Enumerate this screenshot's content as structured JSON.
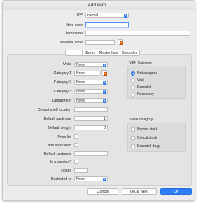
{
  "window": {
    "title": "Add item..."
  },
  "top": {
    "type_label": "Type",
    "type_value": "normal",
    "item_code_label": "Item code",
    "item_code_value": "",
    "item_name_label": "Item name",
    "item_name_value": "",
    "universal_code_label": "Universal code",
    "universal_code_value": ""
  },
  "tabs": [
    {
      "label": ""
    },
    {
      "label": "Stores"
    },
    {
      "label": "Master lists"
    },
    {
      "label": "Barcodes"
    }
  ],
  "form": {
    "units_label": "Units",
    "units_value": "None",
    "category1_label": "Category 1",
    "category1_value": "None",
    "category2_label": "Category 2",
    "category2_value": "None",
    "category3_label": "Category 3",
    "category3_value": "None",
    "department_label": "Department",
    "department_value": "None",
    "shelf_label": "Default shelf location",
    "shelf_value": "",
    "pack_size_label": "Default pack size",
    "pack_size_value": "1",
    "weight_label": "Default weight",
    "weight_value": "0",
    "price_list_label": "Price list",
    "non_stock_label": "Non stock item",
    "customer_label": "Default customer",
    "customer_value": "",
    "vaccine_label": "Is a vaccine?",
    "doses_label": "Doses",
    "doses_value": "",
    "restricted_label": "Restricted to",
    "restricted_value": "None"
  },
  "ven": {
    "title": "VEN Category",
    "options": [
      "Not assigned",
      "Vital",
      "Essential",
      "Necessary"
    ],
    "selected": "Not assigned"
  },
  "stock": {
    "title": "Stock category",
    "options": [
      "Normal stock",
      "Critical stock",
      "Essential drug"
    ]
  },
  "buttons": {
    "cancel": "Cancel",
    "ok_next": "OK & Next",
    "ok": "OK"
  },
  "colors": {
    "accent": "#2f7df6",
    "window_bg": "#ececec",
    "panel_bg": "#e4e4e4"
  }
}
